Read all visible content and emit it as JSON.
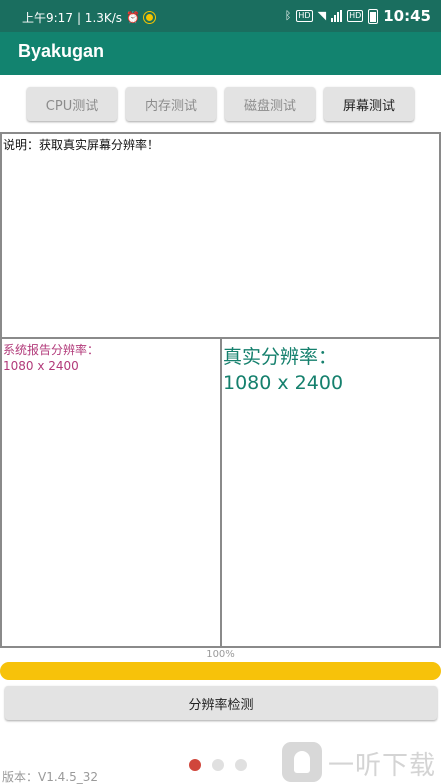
{
  "status_bar": {
    "time_left": "上午9:17",
    "net_speed": "| 1.3K/s",
    "clock": "10:45",
    "icons": [
      "alarm-icon",
      "app-notification-icon",
      "bluetooth-icon",
      "hd-badge-icon",
      "wifi-icon",
      "signal-icon",
      "battery-icon"
    ],
    "hd_label": "HD",
    "hd_label_2": "HD"
  },
  "app_bar": {
    "title": "Byakugan"
  },
  "tabs": [
    {
      "label": "CPU测试",
      "active": false
    },
    {
      "label": "内存测试",
      "active": false
    },
    {
      "label": "磁盘测试",
      "active": false
    },
    {
      "label": "屏幕测试",
      "active": true
    }
  ],
  "description": "说明：获取真实屏幕分辨率！",
  "system_resolution": {
    "label": "系统报告分辨率：",
    "value": "1080 x 2400"
  },
  "real_resolution": {
    "label": "真实分辨率：",
    "value": "1080 x 2400"
  },
  "progress": {
    "percent": 100,
    "text": "100%"
  },
  "detect_button": {
    "label": "分辨率检测"
  },
  "pager": {
    "count": 3,
    "active_index": 0
  },
  "version": "版本：V1.4.5_32",
  "watermark": {
    "text": "一听下载"
  },
  "colors": {
    "status_bar": "#1a6e5f",
    "app_bar": "#12836f",
    "progress_fill": "#f7c20a",
    "system_text": "#b23a7a",
    "real_text": "#15806d",
    "active_dot": "#d0463b"
  }
}
